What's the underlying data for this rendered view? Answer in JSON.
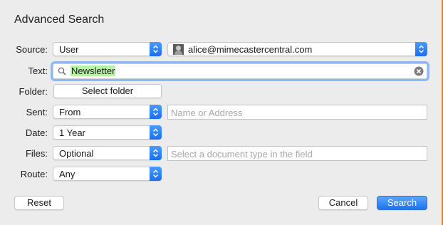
{
  "dialog": {
    "title": "Advanced Search"
  },
  "source": {
    "label": "Source:",
    "type_value": "User",
    "account_value": "alice@mimecastercentral.com"
  },
  "text": {
    "label": "Text:",
    "value": "Newsletter"
  },
  "folder": {
    "label": "Folder:",
    "button": "Select folder"
  },
  "sent": {
    "label": "Sent:",
    "value": "From",
    "placeholder": "Name or Address"
  },
  "date": {
    "label": "Date:",
    "value": "1 Year"
  },
  "files": {
    "label": "Files:",
    "value": "Optional",
    "placeholder": "Select a document type in the field"
  },
  "route": {
    "label": "Route:",
    "value": "Any"
  },
  "buttons": {
    "reset": "Reset",
    "cancel": "Cancel",
    "search": "Search"
  },
  "colors": {
    "accent": "#1e72ef",
    "highlight": "#b9f0a6",
    "focus_ring": "#8db8f0",
    "edge": "#e8811e"
  },
  "icons": {
    "stepper": "chevron-up-down-icon",
    "search": "magnifier-icon",
    "clear": "clear-x-icon",
    "avatar": "user-avatar-icon"
  }
}
